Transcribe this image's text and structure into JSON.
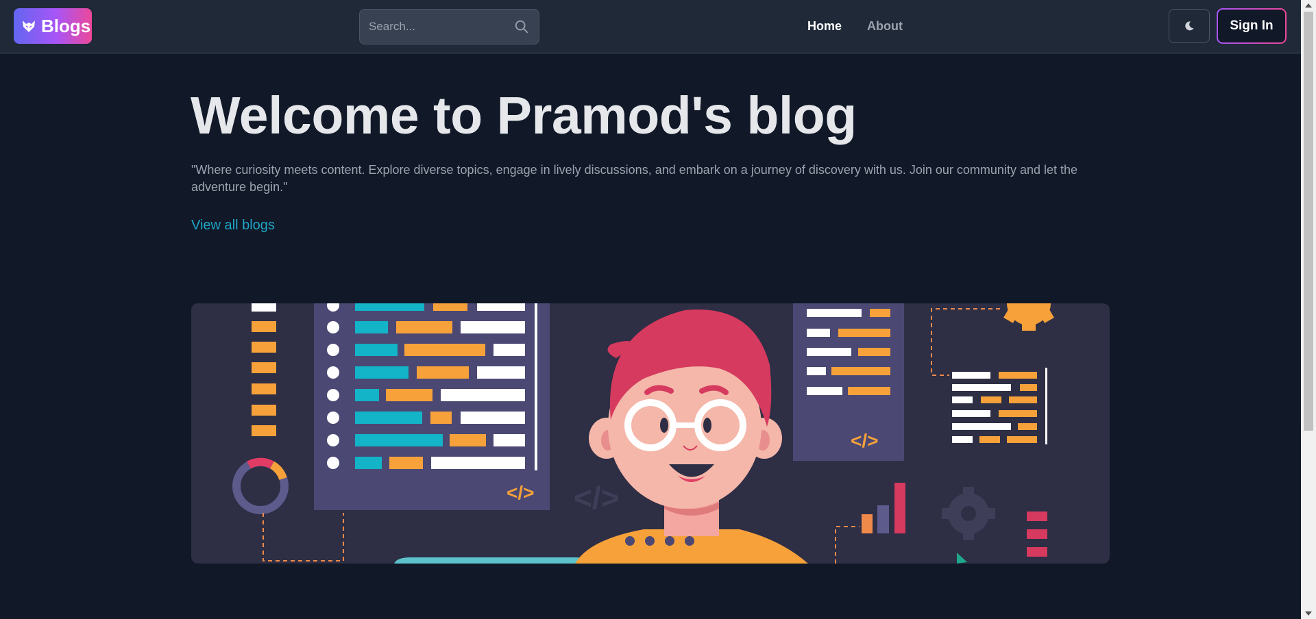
{
  "navbar": {
    "brand_label": "Blogs",
    "brand_icon": "fox-icon",
    "search": {
      "placeholder": "Search...",
      "value": ""
    },
    "links": [
      {
        "label": "Home",
        "active": true
      },
      {
        "label": "About",
        "active": false
      }
    ],
    "theme_toggle_icon": "moon-icon",
    "signin_label": "Sign In"
  },
  "hero": {
    "title": "Welcome to Pramod's blog",
    "description": "\"Where curiosity meets content. Explore diverse topics, engage in lively discussions, and embark on a journey of discovery with us. Join our community and let the adventure begin.\"",
    "link_label": "View all blogs"
  },
  "banner": {
    "code_tag_left": "</>",
    "code_tag_right": "</>",
    "code_tag_faded": "</>"
  },
  "colors": {
    "background": "#111827",
    "navbar": "#1f2937",
    "accent_gradient_start": "#6366f1",
    "accent_gradient_end": "#ec4899",
    "link": "#1ea7c7"
  }
}
